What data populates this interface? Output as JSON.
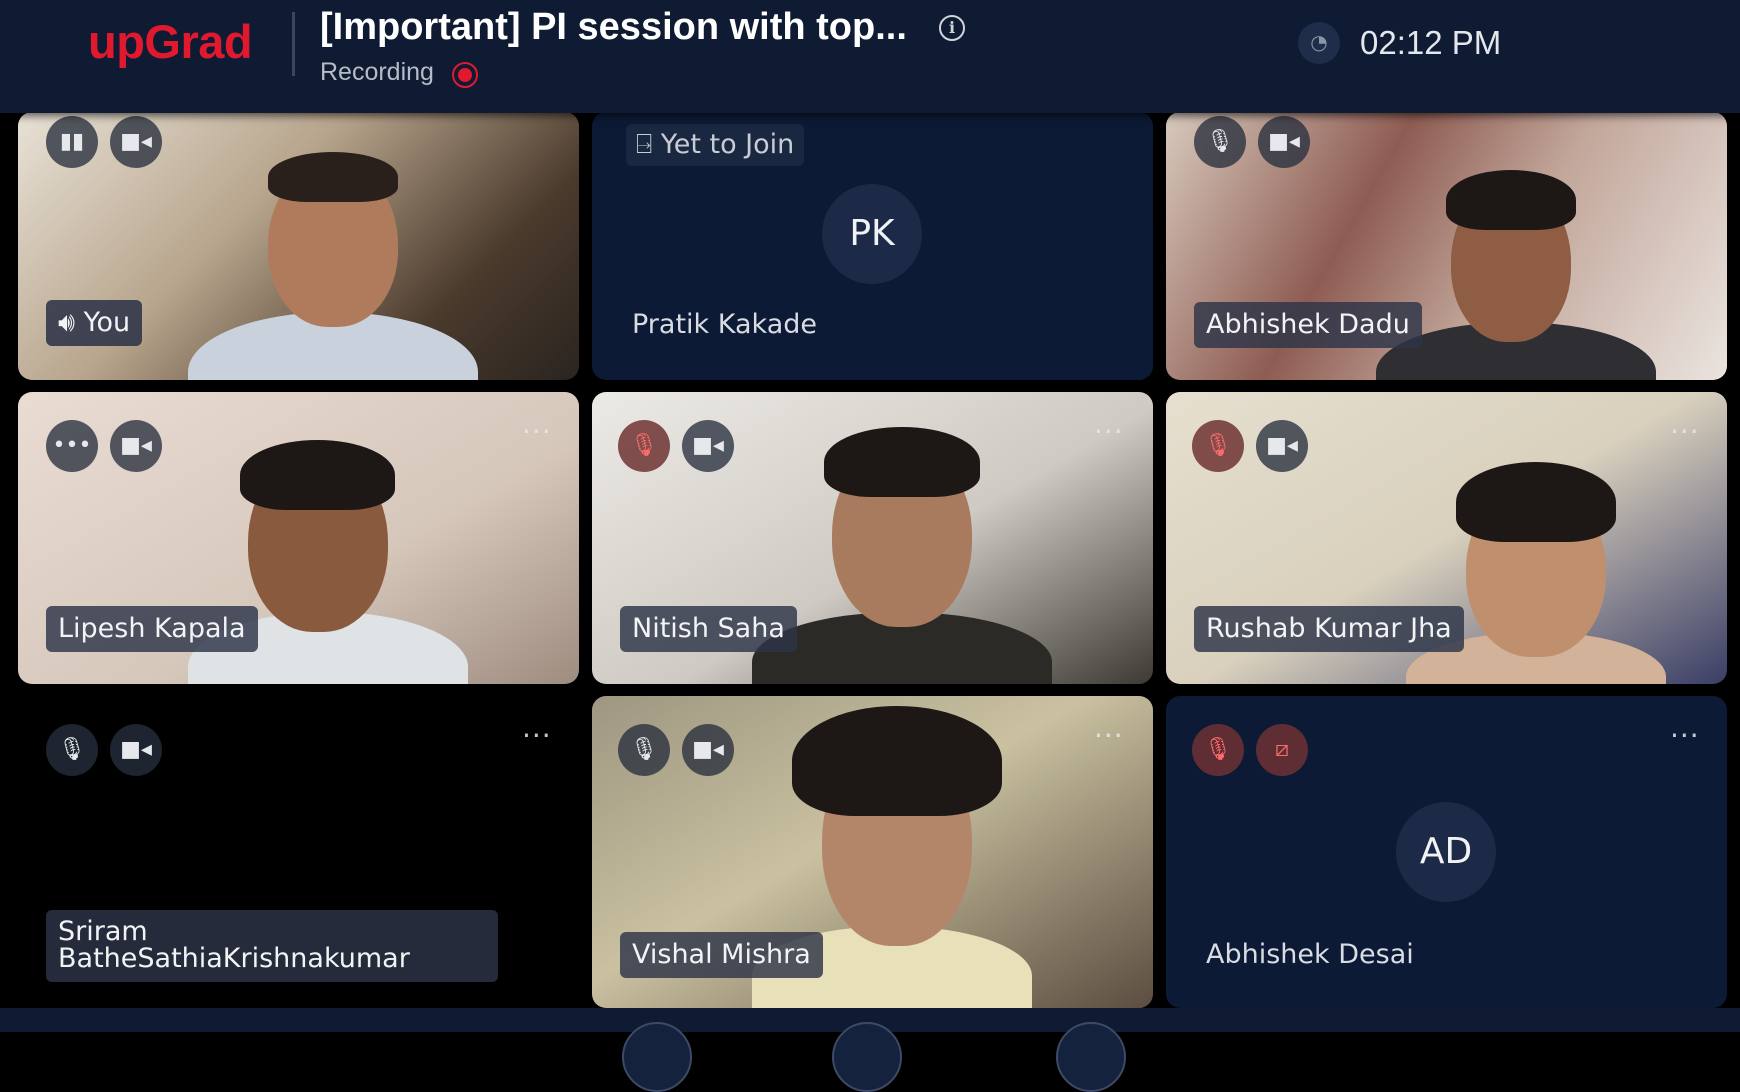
{
  "header": {
    "logo": "upGrad",
    "title": "[Important] PI session with top...",
    "recording_label": "Recording",
    "time": "02:12 PM"
  },
  "icons": {
    "info": "info-icon",
    "recording": "recording-dot-icon",
    "clock": "clock-icon",
    "mic": "microphone-icon",
    "mic_muted": "microphone-muted-icon",
    "camera": "camera-icon",
    "camera_off": "camera-off-icon",
    "more": "more-options-icon",
    "speaking": "speaking-icon",
    "join": "join-door-icon"
  },
  "participants": [
    {
      "name": "You",
      "state": "video",
      "mic": "speaking",
      "camera": "on"
    },
    {
      "name": "Pratik Kakade",
      "state": "waiting",
      "status": "Yet to Join",
      "initials": "PK"
    },
    {
      "name": "Abhishek Dadu",
      "state": "video",
      "mic": "on",
      "camera": "on"
    },
    {
      "name": "Lipesh Kapala",
      "state": "video",
      "mic": "speaking",
      "camera": "on"
    },
    {
      "name": "Nitish Saha",
      "state": "video",
      "mic": "muted",
      "camera": "on"
    },
    {
      "name": "Rushab Kumar Jha",
      "state": "video",
      "mic": "muted",
      "camera": "on"
    },
    {
      "name_line1": "Sriram",
      "name_line2": "BatheSathiaKrishnakumar",
      "state": "no-video",
      "mic": "on",
      "camera": "on"
    },
    {
      "name": "Vishal Mishra",
      "state": "video",
      "mic": "on",
      "camera": "on"
    },
    {
      "name": "Abhishek Desai",
      "state": "avatar",
      "initials": "AD",
      "mic": "muted",
      "camera": "off"
    }
  ],
  "colors": {
    "brand": "#e0192f",
    "header_bg": "#0e1b33",
    "tile_navy": "#0c1a35",
    "muted_red": "#ff6a6a"
  }
}
